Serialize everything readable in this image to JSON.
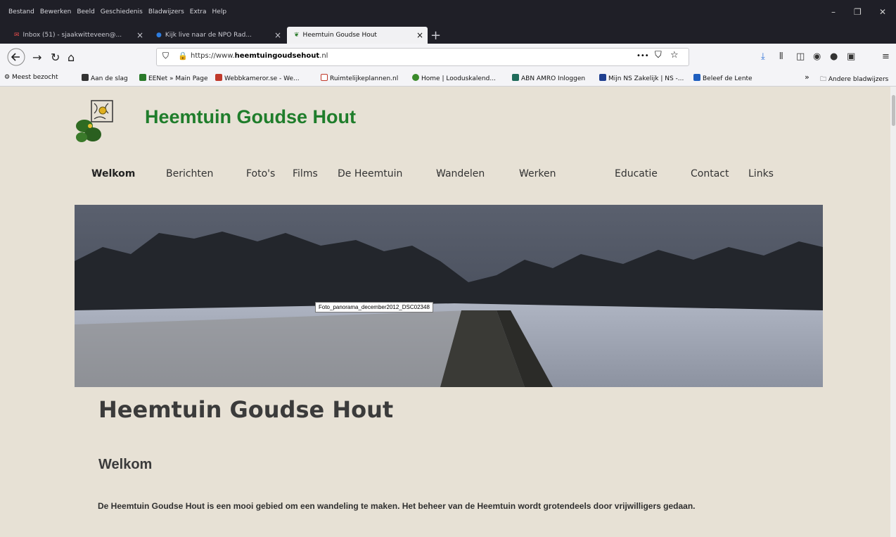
{
  "browser": {
    "menu": [
      "Bestand",
      "Bewerken",
      "Beeld",
      "Geschiedenis",
      "Bladwijzers",
      "Extra",
      "Help"
    ],
    "window_controls": [
      "–",
      "❐",
      "✕"
    ],
    "tabs": [
      {
        "label": "Inbox (51) - sjaakwitteveen@..."
      },
      {
        "label": "Kijk live naar de NPO Rad..."
      },
      {
        "label": "Heemtuin Goudse Hout"
      }
    ],
    "new_tab": "+",
    "url_prefix": "https://www.",
    "url_domain": "heemtuingoudsehout",
    "url_suffix": ".nl",
    "url_more": "•••",
    "bookmarks": [
      {
        "label": "Meest bezocht",
        "color": "#555555"
      },
      {
        "label": "Aan de slag",
        "color": "#333333"
      },
      {
        "label": "EENet » Main Page",
        "color": "#2a7a2a"
      },
      {
        "label": "Webbkameror.se - We...",
        "color": "#c0392b"
      },
      {
        "label": "Ruimtelijkeplannen.nl",
        "color": "#c0392b"
      },
      {
        "label": "Home | Looduskalend...",
        "color": "#3a8a2a"
      },
      {
        "label": "ABN AMRO Inloggen",
        "color": "#1f6b5a"
      },
      {
        "label": "Mijn NS Zakelijk | NS -...",
        "color": "#1f3f8f"
      },
      {
        "label": "Beleef de Lente",
        "color": "#1f5fbf"
      }
    ],
    "more_bookmarks": "»",
    "other_bookmarks": "Andere bladwijzers"
  },
  "site": {
    "title": "Heemtuin Goudse Hout",
    "nav": [
      {
        "label": "Welkom",
        "caret": "⌄"
      },
      {
        "label": "Berichten",
        "caret": "⌄"
      },
      {
        "label": "Foto's",
        "caret": ""
      },
      {
        "label": "Films",
        "caret": ""
      },
      {
        "label": "De Heemtuin",
        "caret": "⌄"
      },
      {
        "label": "Wandelen",
        "caret": "⌄"
      },
      {
        "label": "Werken",
        "caret": "⌄"
      },
      {
        "label": "Educatie",
        "caret": "⌄"
      },
      {
        "label": "Contact",
        "caret": ""
      },
      {
        "label": "Links",
        "caret": ""
      }
    ],
    "hero_tooltip": "Foto_panorama_december2012_DSC02348",
    "heading": "Heemtuin Goudse Hout",
    "subheading": "Welkom",
    "paragraph": "De Heemtuin Goudse Hout is een mooi gebied om een wandeling te maken. Het beheer van de Heemtuin wordt grotendeels door vrijwilligers gedaan.",
    "accent_color": "#1f7d2b"
  }
}
